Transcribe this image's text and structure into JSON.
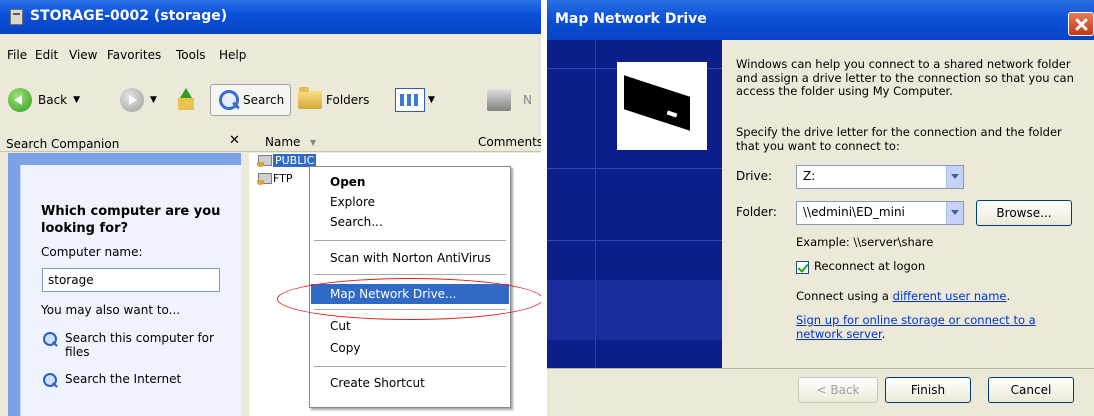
{
  "explorer": {
    "title": "STORAGE-0002 (storage)",
    "menu": [
      "File",
      "Edit",
      "View",
      "Favorites",
      "Tools",
      "Help"
    ],
    "toolbar": {
      "back": "Back",
      "search": "Search",
      "folders": "Folders",
      "cut_off": "N"
    },
    "columns": {
      "companion": "Search Companion",
      "close": "✕",
      "name": "Name",
      "sort": "▼",
      "comments": "Comments"
    },
    "companion": {
      "question": "Which computer are you looking for?",
      "computer_name_label": "Computer name:",
      "computer_name_value": "storage",
      "also_want": "You may also want to...",
      "links": [
        "Search this computer for files",
        "Search the Internet"
      ]
    },
    "files": [
      "PUBLIC",
      "FTP"
    ],
    "context_menu": {
      "open": "Open",
      "explore": "Explore",
      "search": "Search...",
      "scan": "Scan with Norton AntiVirus",
      "map": "Map Network Drive...",
      "cut": "Cut",
      "copy": "Copy",
      "shortcut": "Create Shortcut"
    },
    "highlight_color": "#e81c1c"
  },
  "dialog": {
    "title": "Map Network Drive",
    "intro": "Windows can help you connect to a shared network folder and assign a drive letter to the connection so that you can access the folder using My Computer.",
    "specify": "Specify the drive letter for the connection and the folder that you want to connect to:",
    "drive_label": "Drive:",
    "drive_value": "Z:",
    "folder_label": "Folder:",
    "folder_value": "\\\\edmini\\ED_mini",
    "browse": "Browse...",
    "example": "Example: \\\\server\\share",
    "reconnect": "Reconnect at logon",
    "reconnect_checked": true,
    "connect_prefix": "Connect using a ",
    "connect_link": "different user name",
    "connect_suffix": ".",
    "signup_link": "Sign up for online storage or connect to a network server",
    "signup_suffix": ".",
    "back_btn": "< Back",
    "finish_btn": "Finish",
    "cancel_btn": "Cancel"
  }
}
